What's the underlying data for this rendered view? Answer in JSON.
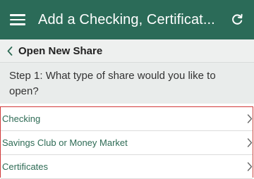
{
  "appbar": {
    "title": "Add a Checking, Certificat...",
    "menu_icon": "hamburger-menu-icon",
    "refresh_icon": "refresh-icon",
    "background": "#2b6b58"
  },
  "subhead": {
    "back_icon": "chevron-left-icon",
    "label": "Open New Share"
  },
  "step": {
    "question": "Step 1: What type of share would you like to open?"
  },
  "share_types": [
    {
      "label": "Checking"
    },
    {
      "label": "Savings Club or Money Market"
    },
    {
      "label": "Certificates"
    }
  ],
  "colors": {
    "accent": "#2e6b55",
    "highlight_border": "#d03a3a"
  }
}
